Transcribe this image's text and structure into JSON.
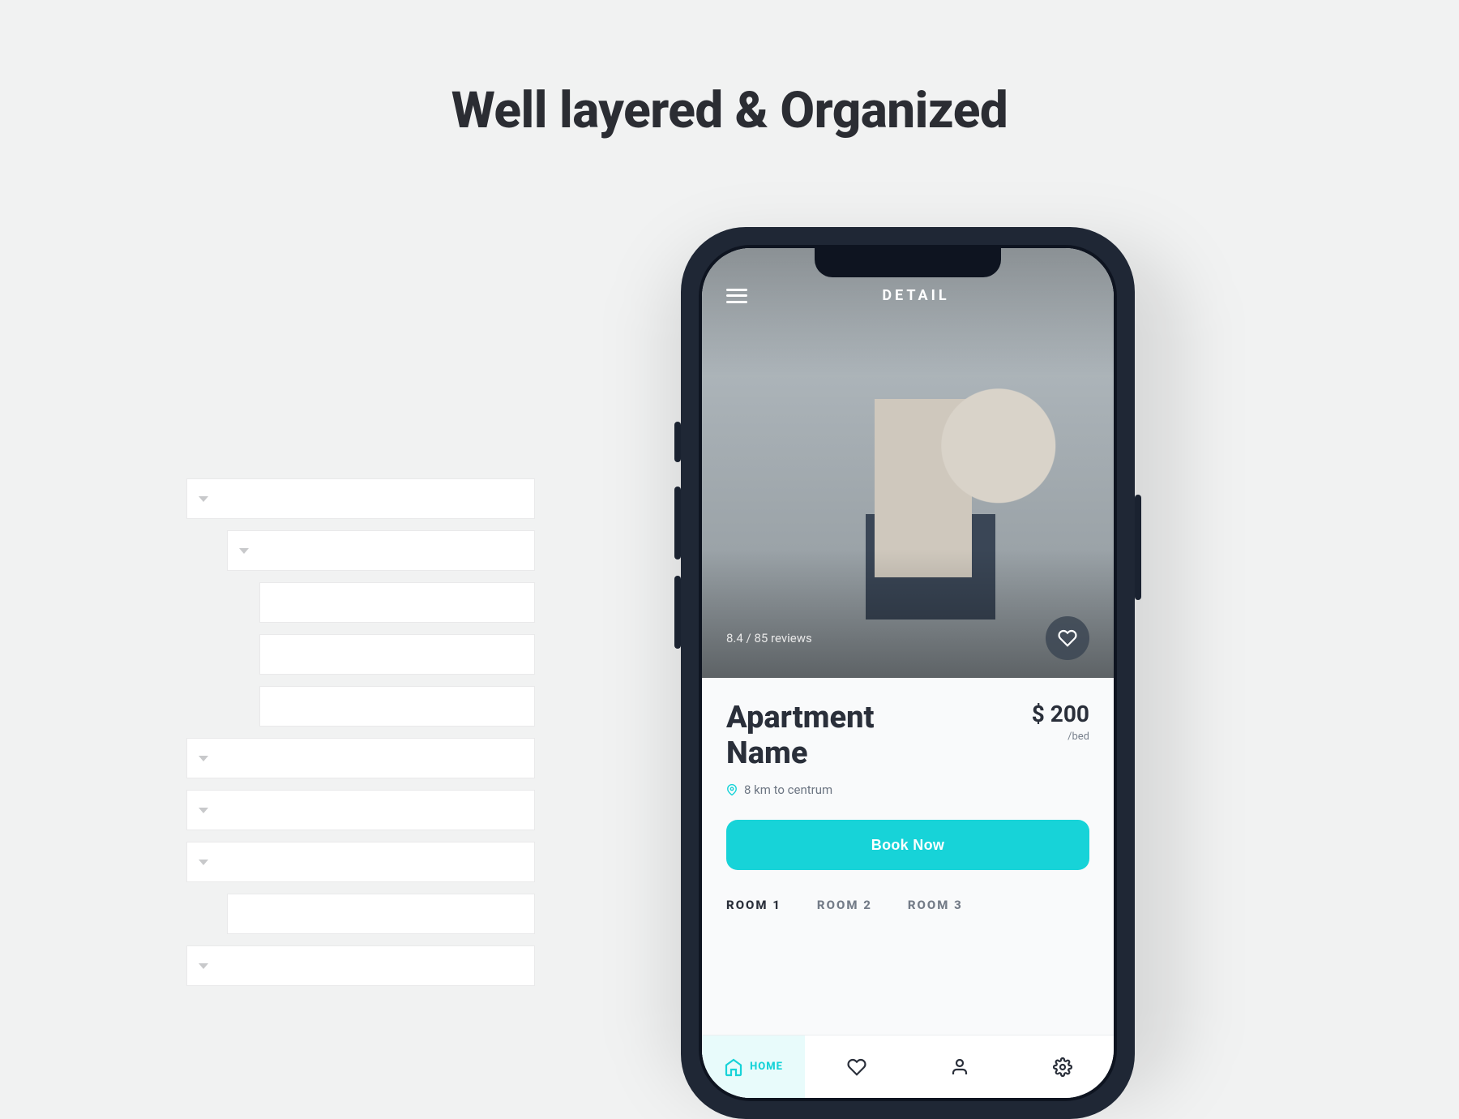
{
  "hero_heading": "Well layered & Organized",
  "layer_panel": {
    "rows": [
      {
        "indent": 0,
        "chev": true
      },
      {
        "indent": 1,
        "chev": true
      },
      {
        "indent": 2,
        "chev": false
      },
      {
        "indent": 2,
        "chev": false
      },
      {
        "indent": 2,
        "chev": false
      },
      {
        "indent": 0,
        "chev": true
      },
      {
        "indent": 0,
        "chev": true
      },
      {
        "indent": 0,
        "chev": true
      },
      {
        "indent": 1,
        "chev": false
      },
      {
        "indent": 0,
        "chev": true
      }
    ]
  },
  "app": {
    "topbar": {
      "title": "DETAIL",
      "menu_icon": "menu-icon"
    },
    "hero": {
      "rating_text": "8.4 / 85 reviews",
      "favorite_icon": "heart-icon"
    },
    "listing": {
      "name": "Apartment Name",
      "price": "$ 200",
      "price_unit": "/bed",
      "distance": "8 km to centrum",
      "book_label": "Book Now"
    },
    "rooms": [
      {
        "label": "ROOM 1",
        "active": true
      },
      {
        "label": "ROOM 2",
        "active": false
      },
      {
        "label": "ROOM 3",
        "active": false
      }
    ],
    "nav": [
      {
        "label": "HOME",
        "icon": "home",
        "active": true,
        "show_label": true
      },
      {
        "label": "",
        "icon": "heart",
        "active": false,
        "show_label": false
      },
      {
        "label": "",
        "icon": "user",
        "active": false,
        "show_label": false
      },
      {
        "label": "",
        "icon": "settings",
        "active": false,
        "show_label": false
      }
    ]
  },
  "colors": {
    "accent": "#17d3d8",
    "text": "#2a2f3a",
    "bg": "#f1f2f2"
  }
}
